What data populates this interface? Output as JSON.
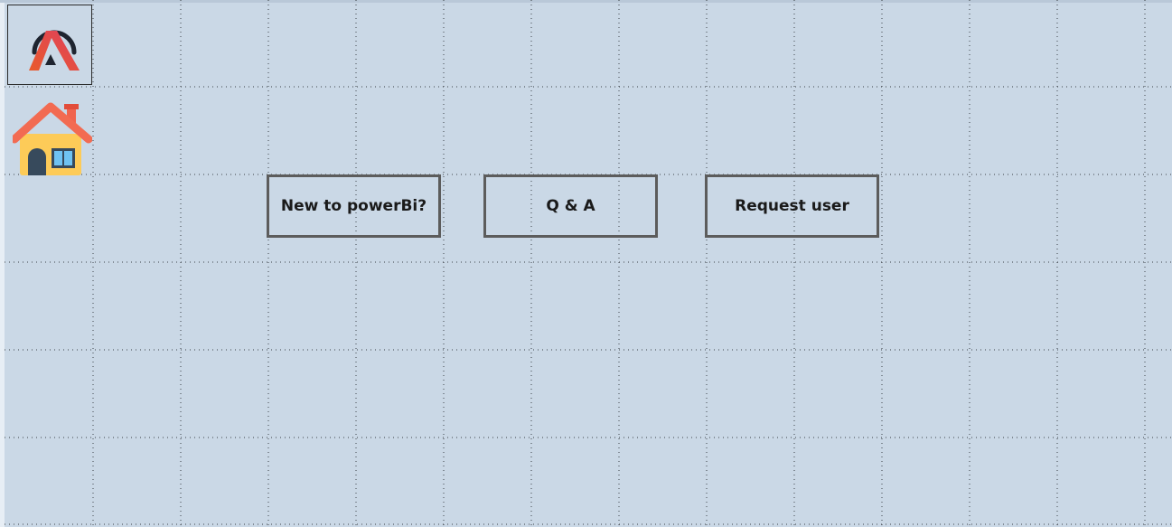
{
  "logo": {
    "icon": "brand-a-logo-icon"
  },
  "home": {
    "icon": "home-icon"
  },
  "buttons": [
    {
      "label": "New to powerBi?"
    },
    {
      "label": "Q & A"
    },
    {
      "label": "Request user"
    }
  ],
  "colors": {
    "background": "#cad8e6",
    "button_border": "#5c5c5c",
    "text": "#1a1a1a"
  }
}
